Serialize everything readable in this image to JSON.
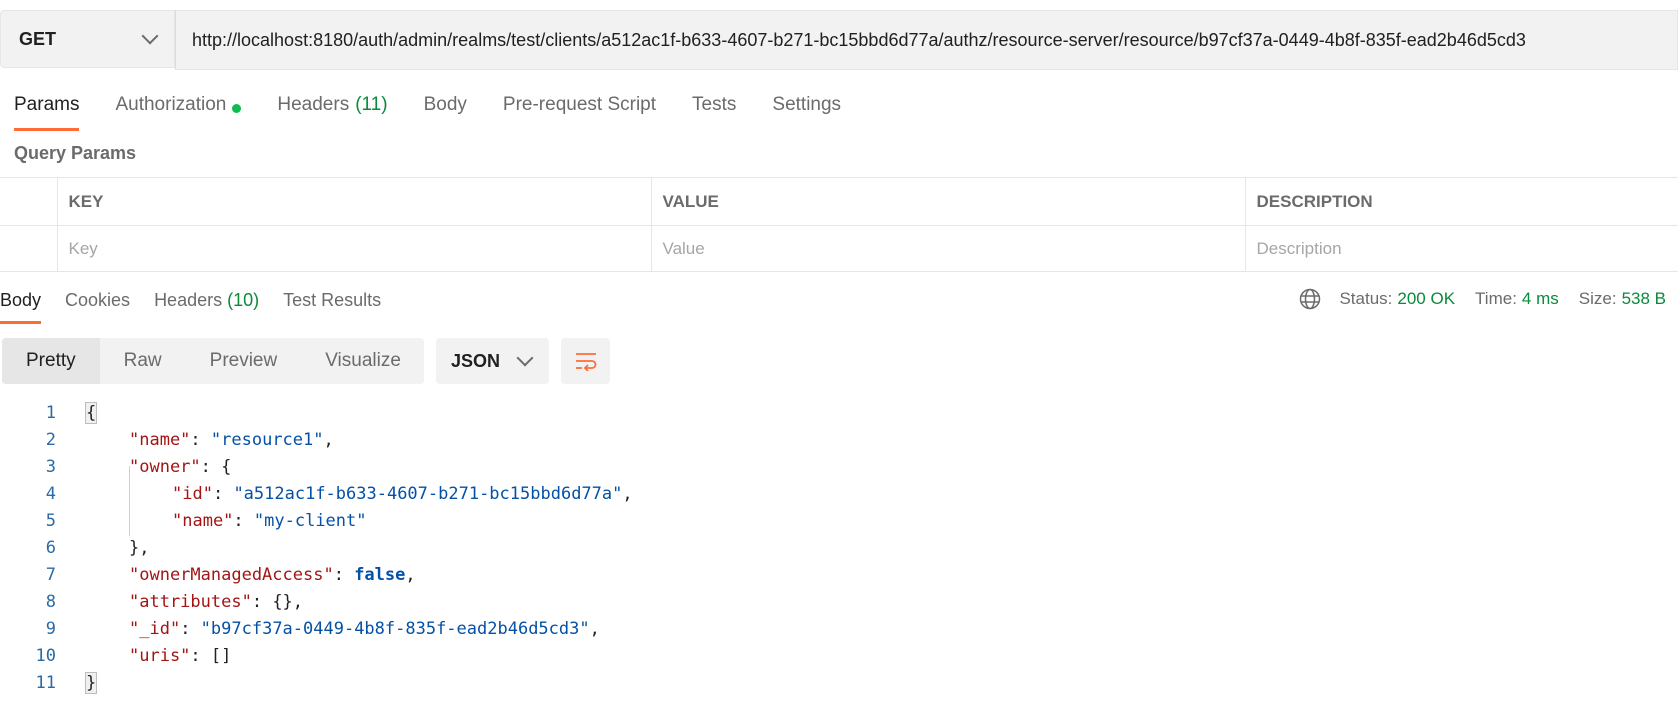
{
  "request": {
    "method": "GET",
    "url": "http://localhost:8180/auth/admin/realms/test/clients/a512ac1f-b633-4607-b271-bc15bbd6d77a/authz/resource-server/resource/b97cf37a-0449-4b8f-835f-ead2b46d5cd3"
  },
  "request_tabs": {
    "params": "Params",
    "authorization": "Authorization",
    "headers": "Headers",
    "headers_count": "(11)",
    "body": "Body",
    "prerequest": "Pre-request Script",
    "tests": "Tests",
    "settings": "Settings"
  },
  "query_params": {
    "title": "Query Params",
    "headers": {
      "key": "KEY",
      "value": "VALUE",
      "description": "DESCRIPTION"
    },
    "placeholders": {
      "key": "Key",
      "value": "Value",
      "description": "Description"
    }
  },
  "response_tabs": {
    "body": "Body",
    "cookies": "Cookies",
    "headers": "Headers",
    "headers_count": "(10)",
    "test_results": "Test Results"
  },
  "response_status": {
    "status_label": "Status:",
    "status_value": "200 OK",
    "time_label": "Time:",
    "time_value": "4 ms",
    "size_label": "Size:",
    "size_value": "538 B"
  },
  "view_modes": {
    "pretty": "Pretty",
    "raw": "Raw",
    "preview": "Preview",
    "visualize": "Visualize",
    "format": "JSON"
  },
  "code": {
    "line_numbers": [
      "1",
      "2",
      "3",
      "4",
      "5",
      "6",
      "7",
      "8",
      "9",
      "10",
      "11"
    ],
    "l1": {
      "open": "{"
    },
    "l2": {
      "key": "\"name\"",
      "sep": ": ",
      "val": "\"resource1\"",
      "end": ","
    },
    "l3": {
      "key": "\"owner\"",
      "sep": ": ",
      "val": "{"
    },
    "l4": {
      "key": "\"id\"",
      "sep": ": ",
      "val": "\"a512ac1f-b633-4607-b271-bc15bbd6d77a\"",
      "end": ","
    },
    "l5": {
      "key": "\"name\"",
      "sep": ": ",
      "val": "\"my-client\""
    },
    "l6": {
      "close": "}",
      "end": ","
    },
    "l7": {
      "key": "\"ownerManagedAccess\"",
      "sep": ": ",
      "val": "false",
      "end": ","
    },
    "l8": {
      "key": "\"attributes\"",
      "sep": ": ",
      "val": "{}",
      "end": ","
    },
    "l9": {
      "key": "\"_id\"",
      "sep": ": ",
      "val": "\"b97cf37a-0449-4b8f-835f-ead2b46d5cd3\"",
      "end": ","
    },
    "l10": {
      "key": "\"uris\"",
      "sep": ": ",
      "val": "[]"
    },
    "l11": {
      "close": "}"
    }
  },
  "colors": {
    "accent": "#ff6c37",
    "success": "#0a8a3c",
    "auth_dot": "#0cbb52",
    "json_key": "#a31515",
    "json_string": "#0451a5"
  }
}
